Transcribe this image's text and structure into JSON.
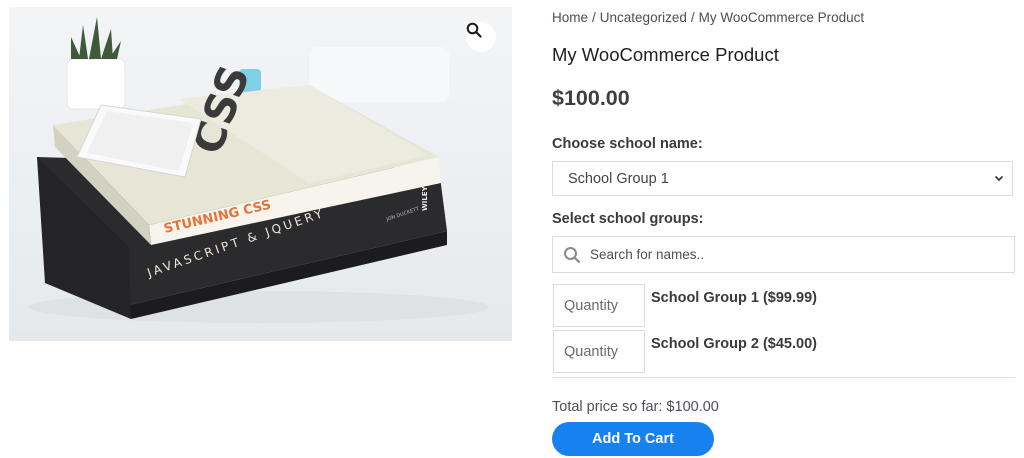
{
  "gallery": {
    "image_alt": "Stack of books with a phone on top",
    "book_texts": {
      "top_spine": "STUNNING CSS",
      "top_cover": "CSS",
      "bottom_spine": "JAVASCRIPT & JQUERY",
      "bottom_publisher": "WILEY",
      "bottom_author": "JON DUCKETT"
    },
    "zoom_icon": "search-icon"
  },
  "breadcrumb": {
    "home": "Home",
    "separator": "/",
    "category": "Uncategorized",
    "current": "My WooCommerce Product"
  },
  "product": {
    "title": "My WooCommerce Product",
    "price": "$100.00"
  },
  "school": {
    "label": "Choose school name:",
    "selected": "School Group 1"
  },
  "groups": {
    "label": "Select school groups:",
    "search_placeholder": "Search for names..",
    "search_icon": "search-icon",
    "items": [
      {
        "qty_placeholder": "Quantity",
        "label": "School Group 1 ($99.99)"
      },
      {
        "qty_placeholder": "Quantity",
        "label": "School Group 2 ($45.00)"
      }
    ]
  },
  "total": {
    "text": "Total price so far: $100.00"
  },
  "cart": {
    "button_label": "Add To Cart"
  },
  "colors": {
    "accent": "#1781f0",
    "text": "#3a3a3a",
    "border": "#dcdcdc"
  }
}
